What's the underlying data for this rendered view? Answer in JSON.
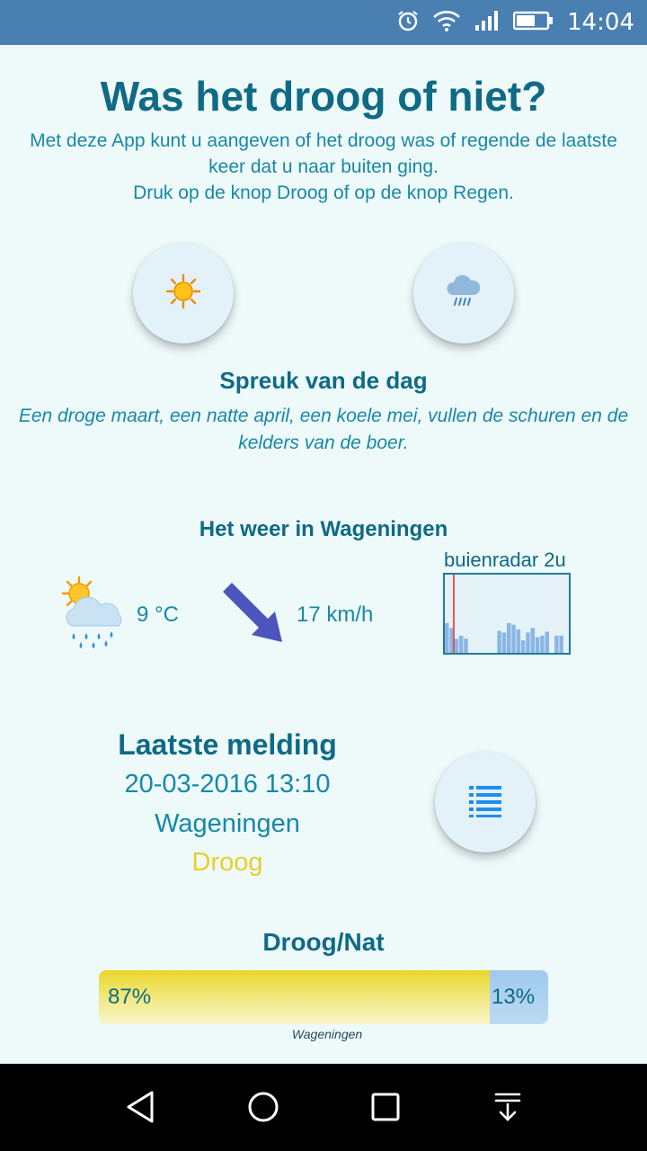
{
  "status": {
    "time": "14:04"
  },
  "header": {
    "title": "Was het droog of niet?",
    "intro_line1": "Met deze App kunt u aangeven of het droog was of regende de laatste keer dat u naar buiten ging.",
    "intro_line2": "Druk op de knop Droog of op de knop Regen."
  },
  "buttons": {
    "dry_icon": "sun-icon",
    "rain_icon": "rain-cloud-icon",
    "list_icon": "list-icon"
  },
  "spreuk": {
    "title": "Spreuk van de dag",
    "text": "Een droge maart, een natte april, een koele mei, vullen de schuren en de kelders van de boer."
  },
  "weather": {
    "title": "Het weer in Wageningen",
    "temperature": "9 °C",
    "wind": "17 km/h",
    "radar_label": "buienradar 2u",
    "condition_icon": "sun-cloud-rain-icon",
    "wind_icon": "wind-arrow-southeast-icon"
  },
  "chart_data": {
    "type": "bar",
    "values": [
      38,
      32,
      18,
      22,
      18,
      0,
      0,
      0,
      0,
      0,
      0,
      28,
      26,
      38,
      36,
      30,
      16,
      26,
      32,
      20,
      22,
      27,
      0,
      22,
      22,
      0
    ],
    "ylim": [
      0,
      100
    ],
    "marker_index": 3
  },
  "melding": {
    "title": "Laatste melding",
    "datetime": "20-03-2016 13:10",
    "location": "Wageningen",
    "status": "Droog"
  },
  "droog_nat": {
    "title": "Droog/Nat",
    "dry_fraction": 0.87,
    "dry_label": "87%",
    "wet_label": "13%",
    "location": "Wageningen"
  },
  "colors": {
    "dry": "#e9d52a",
    "wet": "#9ec9ee",
    "heading": "#0e6a85",
    "text": "#1689a6",
    "statusbar": "#4a7fb2"
  }
}
